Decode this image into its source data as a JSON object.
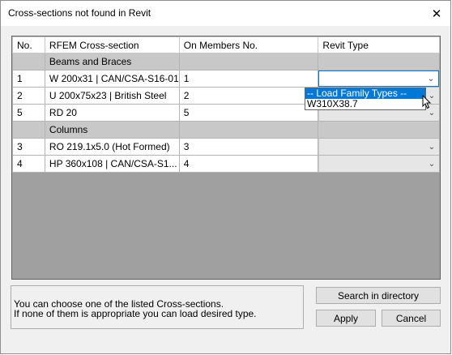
{
  "window": {
    "title": "Cross-sections not found in Revit"
  },
  "table": {
    "columns": [
      "No.",
      "RFEM Cross-section",
      "On Members No.",
      "Revit Type"
    ],
    "rows": [
      {
        "kind": "group",
        "label": "Beams and Braces"
      },
      {
        "kind": "data",
        "no": "1",
        "section": "W 200x31 | CAN/CSA-S16-01",
        "members": "1",
        "revit_type": ""
      },
      {
        "kind": "data",
        "no": "2",
        "section": "U 200x75x23 | British Steel",
        "members": "2",
        "revit_type": ""
      },
      {
        "kind": "data",
        "no": "5",
        "section": "RD 20",
        "members": "5",
        "revit_type": ""
      },
      {
        "kind": "group",
        "label": "Columns"
      },
      {
        "kind": "data",
        "no": "3",
        "section": "RO 219.1x5.0 (Hot Formed)",
        "members": "3",
        "revit_type": ""
      },
      {
        "kind": "data",
        "no": "4",
        "section": "HP 360x108 | CAN/CSA-S1...",
        "members": "4",
        "revit_type": ""
      }
    ]
  },
  "dropdown": {
    "items": [
      "-- Load Family Types --",
      "W310X38.7"
    ],
    "highlighted_index": 0
  },
  "info": {
    "line1": "You can choose one of the listed Cross-sections.",
    "line2": "If none of them is appropriate you can load desired type."
  },
  "buttons": {
    "search": "Search in directory",
    "apply": "Apply",
    "cancel": "Cancel"
  },
  "icons": {
    "close": "close-icon",
    "dropdown": "chevron-down-icon",
    "cursor": "mouse-pointer-icon"
  }
}
